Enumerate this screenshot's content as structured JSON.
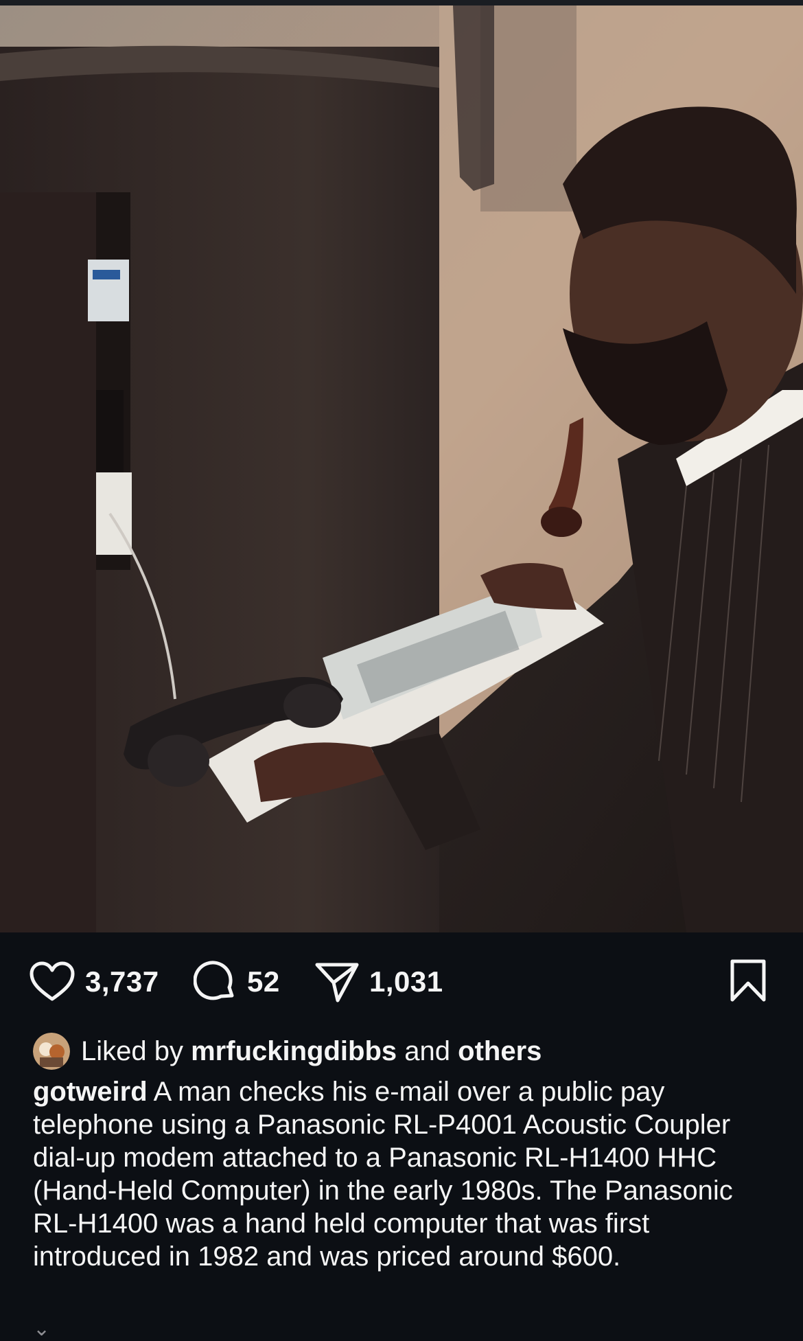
{
  "post": {
    "image": {
      "alt": "Photo of a man with a pipe using a hand-held computer and acoustic coupler at a public pay telephone",
      "icon": "photo"
    },
    "actions": {
      "likes_count": "3,737",
      "comments_count": "52",
      "shares_count": "1,031",
      "like_icon": "heart-icon",
      "comment_icon": "comment-bubble-icon",
      "share_icon": "paper-plane-icon",
      "save_icon": "bookmark-icon"
    },
    "liked_by": {
      "prefix": "Liked by",
      "user": "mrfuckingdibbs",
      "middle": "and",
      "others": "others"
    },
    "caption": {
      "username": "gotweird",
      "text": "A man checks his e-mail over a public pay telephone using a Panasonic RL-P4001 Acoustic Coupler dial-up modem attached to a Panasonic RL-H1400 HHC (Hand-Held Computer) in the early 1980s. The Panasonic RL-H1400 was a hand held computer that was first introduced in 1982 and was priced around $600."
    },
    "colors": {
      "background": "#0c0f14",
      "text": "#f5f5f5",
      "muted": "#8e8e93"
    }
  }
}
